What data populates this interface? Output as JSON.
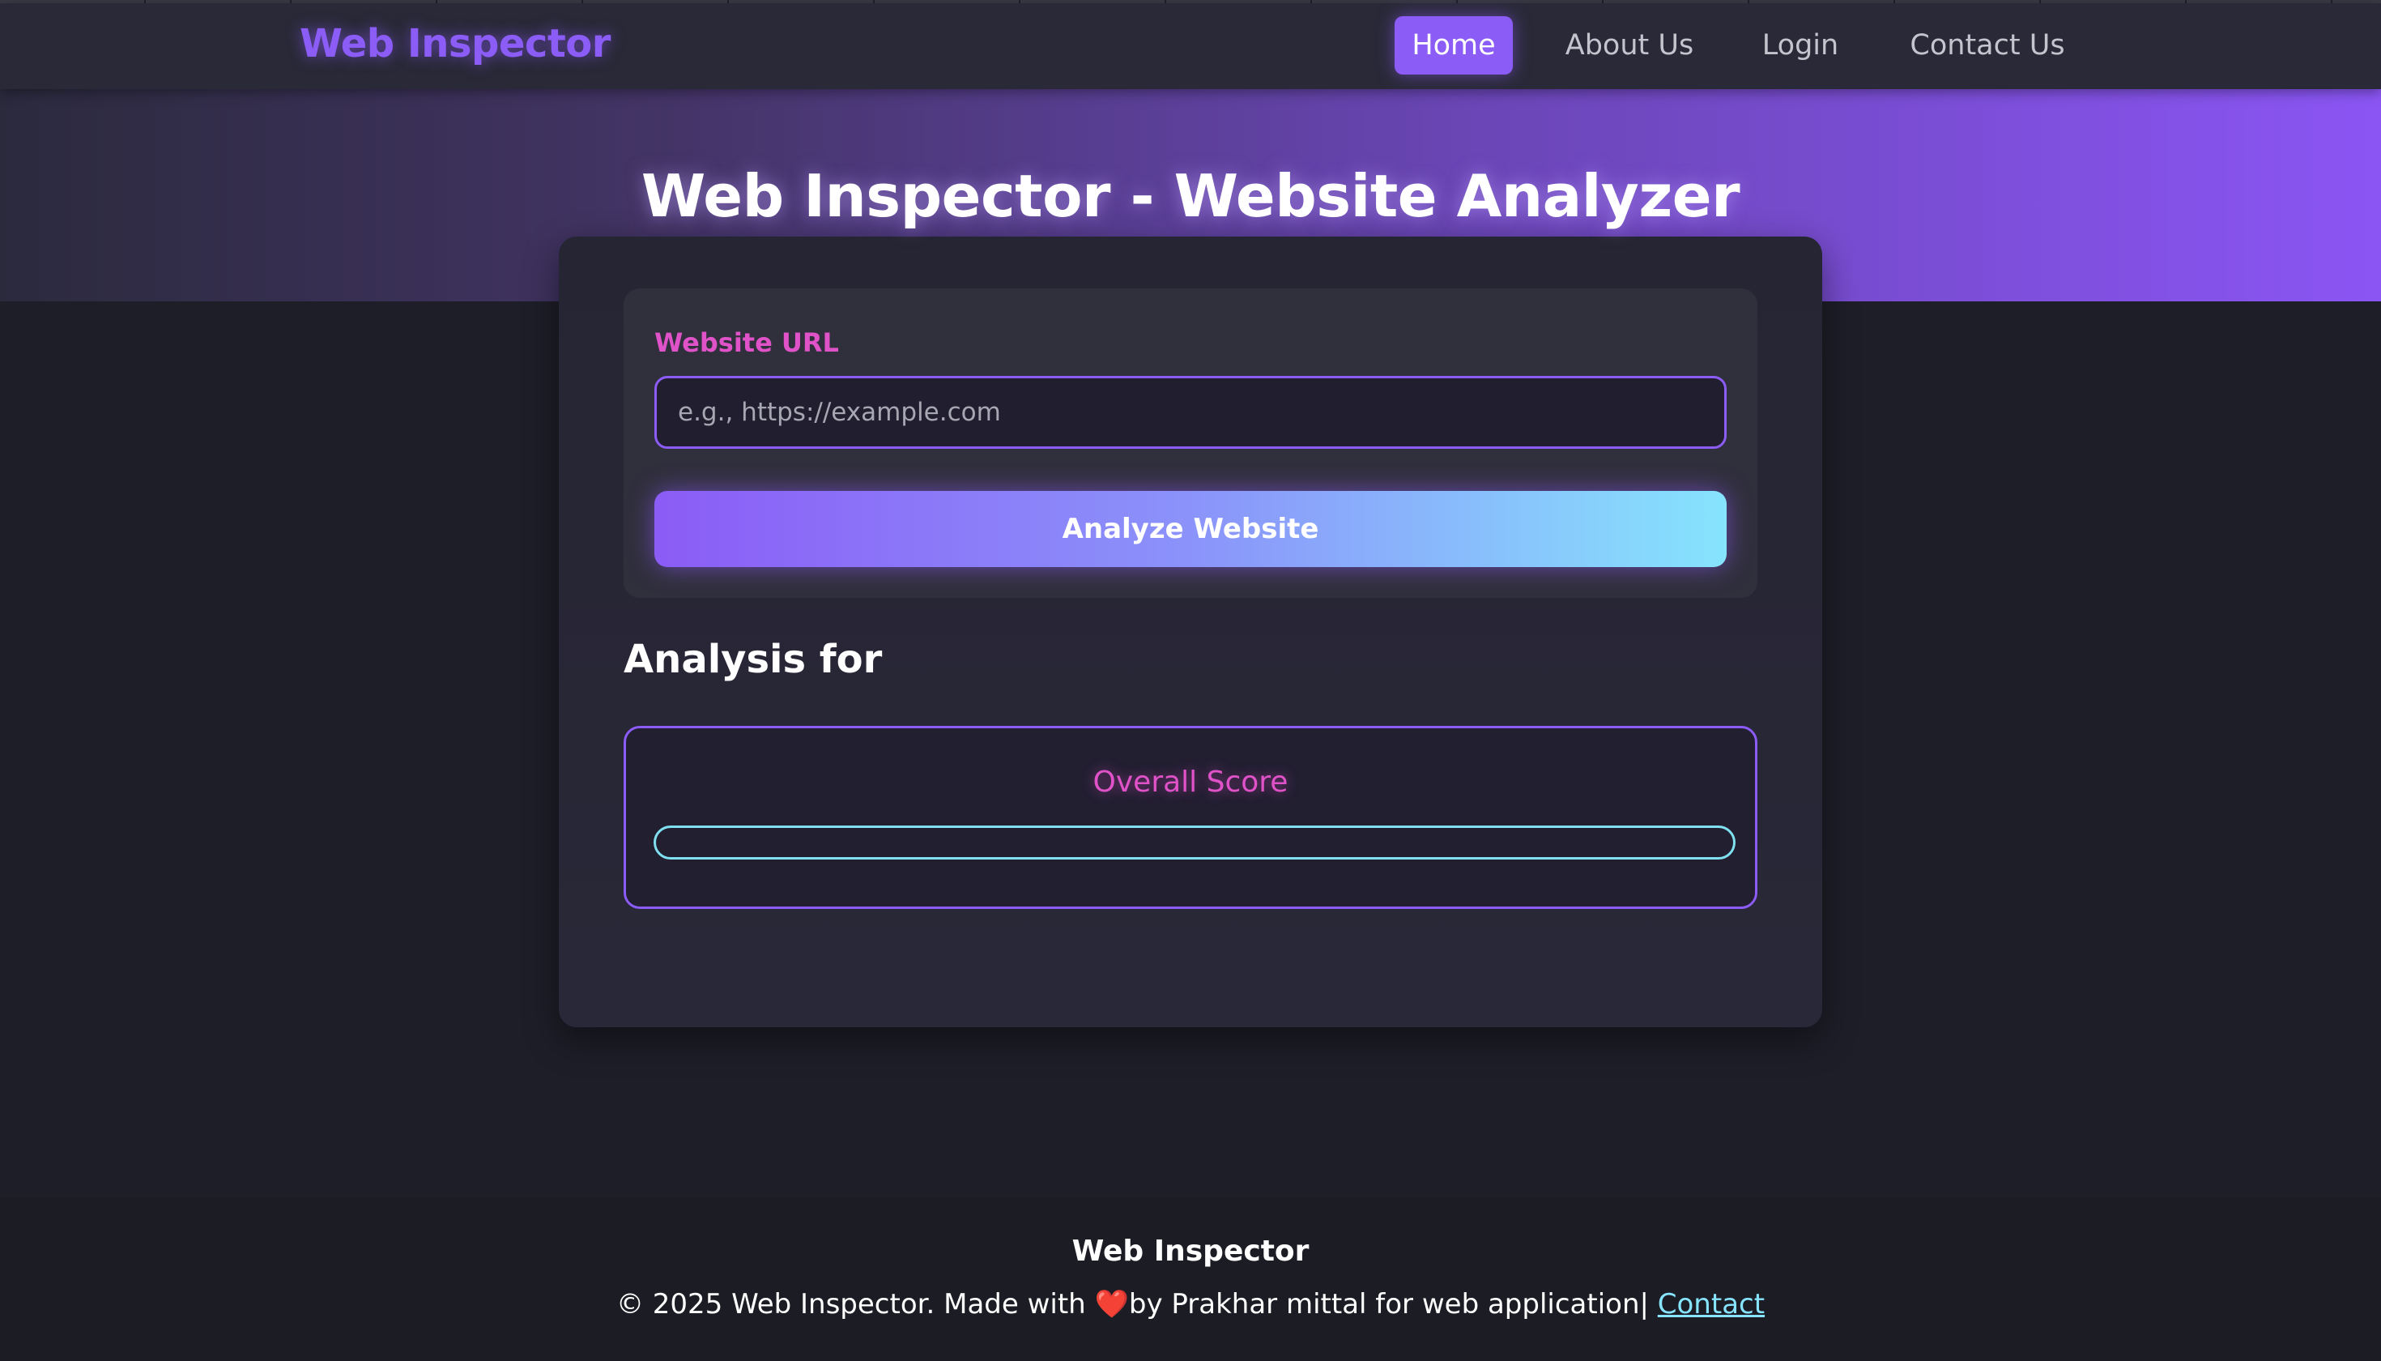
{
  "navbar": {
    "brand": "Web Inspector",
    "items": [
      {
        "label": "Home",
        "active": true
      },
      {
        "label": "About Us",
        "active": false
      },
      {
        "label": "Login",
        "active": false
      },
      {
        "label": "Contact Us",
        "active": false
      }
    ]
  },
  "hero": {
    "title": "Web Inspector - Website Analyzer"
  },
  "form": {
    "url_label": "Website URL",
    "url_placeholder": "e.g., https://example.com",
    "url_value": "",
    "analyze_label": "Analyze Website"
  },
  "analysis": {
    "heading": "Analysis for",
    "score_label": "Overall Score",
    "score_progress": 0
  },
  "footer": {
    "brand": "Web Inspector",
    "text_before_heart": "© 2025 Web Inspector. Made with ",
    "heart_glyph": "❤️",
    "text_after_heart": "by Prakhar mittal for web application| ",
    "link_label": "Contact"
  },
  "colors": {
    "accent_purple": "#8b5cf6",
    "accent_pink": "#e052c8",
    "accent_cyan": "#86e4fd",
    "background": "#1e1e29",
    "card": "#262533"
  }
}
